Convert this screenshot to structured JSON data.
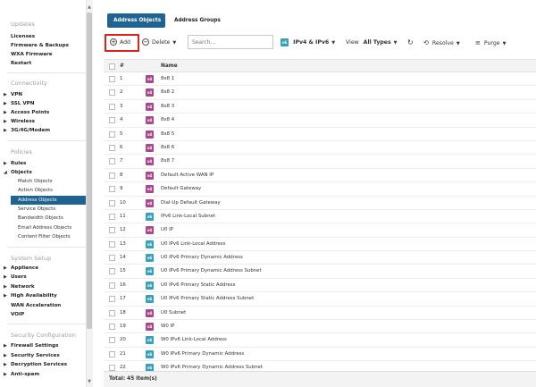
{
  "sidebar": {
    "sections": [
      {
        "title": "Updates",
        "items": [
          "Licenses",
          "Firmware & Backups",
          "WXA Firmware",
          "Restart"
        ]
      },
      {
        "title": "Connectivity",
        "items": [
          "VPN",
          "SSL VPN",
          "Access Points",
          "Wireless",
          "3G/4G/Modem"
        ]
      },
      {
        "title": "Policies",
        "items": [
          "Rules",
          "Objects"
        ]
      },
      {
        "title": "System Setup",
        "items": [
          "Appliance",
          "Users",
          "Network",
          "High Availability",
          "WAN Acceleration",
          "VOIP"
        ]
      },
      {
        "title": "Security Configuration",
        "items": [
          "Firewall Settings",
          "Security Services",
          "Decryption Services",
          "Anti-spam"
        ]
      }
    ],
    "object_subitems": [
      "Match Objects",
      "Action Objects",
      "Address Objects",
      "Service Objects",
      "Bandwidth Objects",
      "Email Address Objects",
      "Content Filter Objects"
    ],
    "active_item": "Address Objects"
  },
  "tabs": {
    "address_objects": "Address Objects",
    "address_groups": "Address Groups"
  },
  "toolbar": {
    "add": "Add",
    "delete": "Delete",
    "search_placeholder": "Search...",
    "ip_filter": "IPv4 & IPv6",
    "view_label": "View",
    "view_value": "All Types",
    "resolve": "Resolve",
    "purge": "Purge",
    "badge_v4": "v4",
    "badge_v6": "v6"
  },
  "table": {
    "col_number": "#",
    "col_name": "Name",
    "rows": [
      {
        "n": "1",
        "type": "v4",
        "name": "8x8 1"
      },
      {
        "n": "2",
        "type": "v4",
        "name": "8x8 2"
      },
      {
        "n": "3",
        "type": "v4",
        "name": "8x8 3"
      },
      {
        "n": "4",
        "type": "v4",
        "name": "8x8 4"
      },
      {
        "n": "5",
        "type": "v4",
        "name": "8x8 5"
      },
      {
        "n": "6",
        "type": "v4",
        "name": "8x8 6"
      },
      {
        "n": "7",
        "type": "v4",
        "name": "8x8 7"
      },
      {
        "n": "8",
        "type": "v4",
        "name": "Default Active WAN IP"
      },
      {
        "n": "9",
        "type": "v4",
        "name": "Default Gateway"
      },
      {
        "n": "10",
        "type": "v4",
        "name": "Dial-Up Default Gateway"
      },
      {
        "n": "11",
        "type": "v6",
        "name": "IPv6 Link-Local Subnet"
      },
      {
        "n": "12",
        "type": "v4",
        "name": "U0 IP"
      },
      {
        "n": "13",
        "type": "v6",
        "name": "U0 IPv6 Link-Local Address"
      },
      {
        "n": "14",
        "type": "v6",
        "name": "U0 IPv6 Primary Dynamic Address"
      },
      {
        "n": "15",
        "type": "v6",
        "name": "U0 IPv6 Primary Dynamic Address Subnet"
      },
      {
        "n": "16",
        "type": "v6",
        "name": "U0 IPv6 Primary Static Address"
      },
      {
        "n": "17",
        "type": "v6",
        "name": "U0 IPv6 Primary Static Address Subnet"
      },
      {
        "n": "18",
        "type": "v4",
        "name": "U0 Subnet"
      },
      {
        "n": "19",
        "type": "v4",
        "name": "W0 IP"
      },
      {
        "n": "20",
        "type": "v6",
        "name": "W0 IPv6 Link-Local Address"
      },
      {
        "n": "21",
        "type": "v6",
        "name": "W0 IPv6 Primary Dynamic Address"
      },
      {
        "n": "22",
        "type": "v6",
        "name": "W0 IPv6 Primary Dynamic Address Subnet"
      }
    ],
    "footer": "Total: 45 item(s)"
  },
  "colors": {
    "accent": "#1f6392",
    "highlight_box": "#d9261c",
    "ipv4_badge": "#a8498c",
    "ipv6_badge": "#3a9fb8"
  }
}
